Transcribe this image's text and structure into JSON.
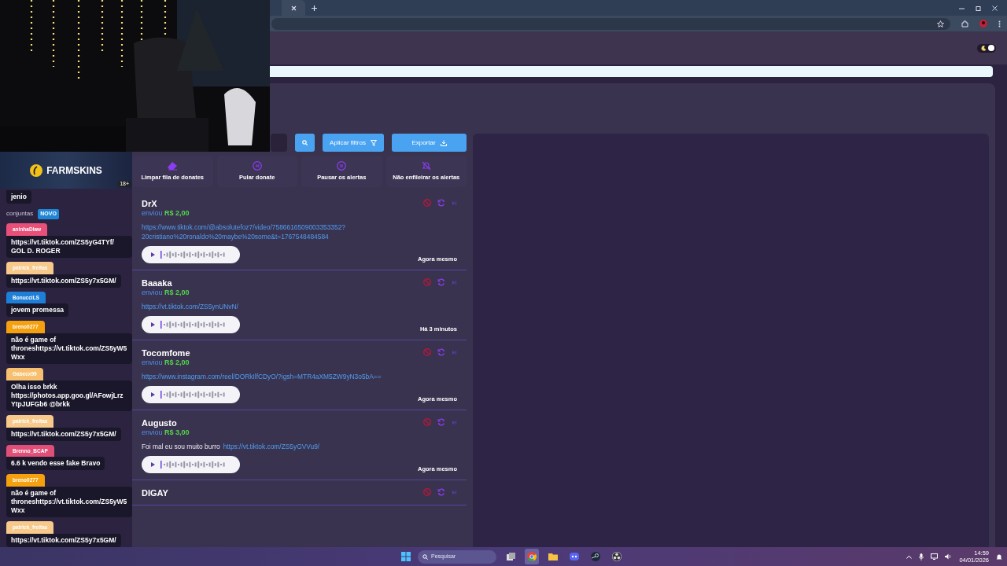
{
  "theme_toggle": {
    "on": true
  },
  "sidebar": {
    "items": [
      {
        "label": "conjuntas",
        "badge": "NOVO"
      }
    ]
  },
  "toolbar": {
    "buttons": [
      {
        "kind": "search"
      },
      {
        "kind": "filter",
        "label": "Aplicar filtros"
      },
      {
        "kind": "export",
        "label": "Exportar"
      }
    ]
  },
  "actions": [
    {
      "kind": "eraser",
      "label": "Limpar fila de donates"
    },
    {
      "kind": "skip",
      "label": "Pular donate"
    },
    {
      "kind": "pause",
      "label": "Pausar os alertas"
    },
    {
      "kind": "bell-off",
      "label": "Não enfileirar os alertas"
    }
  ],
  "donations": [
    {
      "name": "DrX",
      "verb": "enviou",
      "amount": "R$ 2,00",
      "link_lines": [
        "https://www.tiktok.com/@absolutefoz7/video/7586616509003353352?",
        "20cristiano%20ronaldo%20maybe%20some&t=1767548484584"
      ],
      "time": "Agora mesmo"
    },
    {
      "name": "Baaaka",
      "verb": "enviou",
      "amount": "R$ 2,00",
      "link_lines": [
        "https://vt.tiktok.com/ZS5ynUNvN/"
      ],
      "time": "Há 3 minutos"
    },
    {
      "name": "Tocomfome",
      "verb": "enviou",
      "amount": "R$ 2,00",
      "link_lines": [
        "https://www.instagram.com/reel/DORkIlfCDyO/?igsh=MTR4aXM5ZW9yN3o5bA=="
      ],
      "time": "Agora mesmo"
    },
    {
      "name": "Augusto",
      "verb": "enviou",
      "amount": "R$ 3,00",
      "message": "Foi mal eu sou muito burro",
      "link_lines": [
        "https://vt.tiktok.com/ZS5yGVVu9/"
      ],
      "time": "Agora mesmo"
    },
    {
      "name": "DIGAY"
    }
  ],
  "overlay": {
    "sponsor": {
      "name": "FARMSKINS",
      "age_badge": "18+"
    },
    "chat": [
      {
        "text": "jenio"
      },
      {
        "user": "aninhaDlaw",
        "color": "#e8507a",
        "text": "https://vt.tiktok.com/ZS5yG4TYf/ GOL D. ROGER"
      },
      {
        "user": "patrick_freitas",
        "color": "#f7c98a",
        "text": "https://vt.tiktok.com/ZS5y7x5GM/"
      },
      {
        "user": "BonucciLS",
        "color": "#1e7fd8",
        "text": "jovem promessa"
      },
      {
        "user": "breno0277",
        "color": "#f5a00f",
        "text": "não é game of throneshttps://vt.tiktok.com/ZS5yW5Wxx"
      },
      {
        "user": "Gabecx99",
        "color": "#f7c070",
        "text": "Olha isso brkk https://photos.app.goo.gl/AFowjLrzYtpJUFGb6 @brkk"
      },
      {
        "user": "patrick_freitas",
        "color": "#f7c98a",
        "text": "https://vt.tiktok.com/ZS5y7x5GM/"
      },
      {
        "user": "Brenno_BCAP",
        "color": "#e04f78",
        "text": "6.6 k vendo esse fake Bravo"
      },
      {
        "user": "breno0277",
        "color": "#f5a00f",
        "text": "não é game of throneshttps://vt.tiktok.com/ZS5yW5Wxx"
      },
      {
        "user": "patrick_freitas",
        "color": "#f7c98a",
        "text": "https://vt.tiktok.com/ZS5y7x5GM/"
      }
    ]
  },
  "taskbar": {
    "search_placeholder": "Pesquisar",
    "time": "14:59",
    "date": "04/01/2026",
    "apps": [
      {
        "kind": "taskview",
        "active": false
      },
      {
        "kind": "chrome",
        "active": true
      },
      {
        "kind": "folder",
        "active": false
      },
      {
        "kind": "discord",
        "active": false
      },
      {
        "kind": "steam",
        "active": false
      },
      {
        "kind": "obs",
        "active": false
      }
    ]
  }
}
